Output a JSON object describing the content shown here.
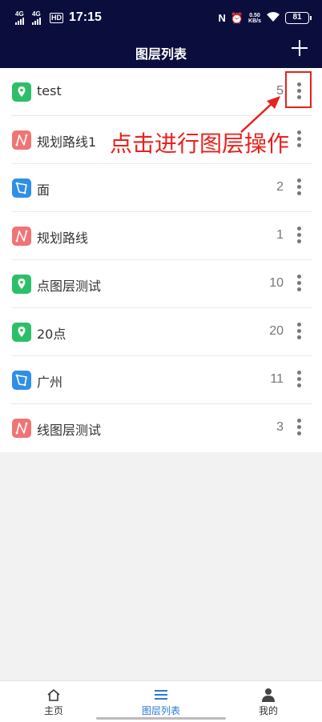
{
  "status_bar": {
    "sim1": "4G",
    "sim2": "4G",
    "hd": "HD",
    "time": "17:15",
    "speed_value": "0.50",
    "speed_unit": "KB/s",
    "battery": "81"
  },
  "header": {
    "title": "图层列表"
  },
  "layers": [
    {
      "name": "test",
      "count": "5",
      "type": "point",
      "color": "#2dbf68"
    },
    {
      "name": "规划路线1",
      "count": "",
      "type": "line",
      "color": "#f07474"
    },
    {
      "name": "面",
      "count": "2",
      "type": "polygon",
      "color": "#2f8fe8"
    },
    {
      "name": "规划路线",
      "count": "1",
      "type": "line",
      "color": "#f07474"
    },
    {
      "name": "点图层测试",
      "count": "10",
      "type": "point",
      "color": "#2dbf68"
    },
    {
      "name": "20点",
      "count": "20",
      "type": "point",
      "color": "#2dbf68"
    },
    {
      "name": "广州",
      "count": "11",
      "type": "polygon",
      "color": "#2f8fe8"
    },
    {
      "name": "线图层测试",
      "count": "3",
      "type": "line",
      "color": "#f07474"
    }
  ],
  "annotation": {
    "text": "点击进行图层操作",
    "color": "#e8211b"
  },
  "tabs": [
    {
      "label": "主页",
      "icon": "home-icon"
    },
    {
      "label": "图层列表",
      "icon": "list-icon"
    },
    {
      "label": "我的",
      "icon": "user-icon"
    }
  ],
  "accent": "#2a78d4"
}
